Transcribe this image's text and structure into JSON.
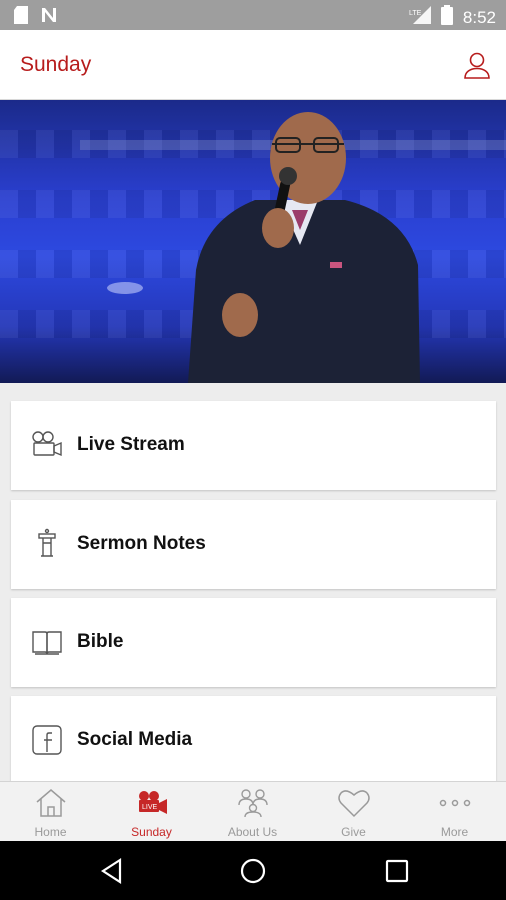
{
  "status_bar": {
    "time": "8:52"
  },
  "app_bar": {
    "title": "Sunday"
  },
  "menu": {
    "items": [
      {
        "label": "Live Stream",
        "icon": "video-camera-icon"
      },
      {
        "label": "Sermon Notes",
        "icon": "podium-icon"
      },
      {
        "label": "Bible",
        "icon": "open-book-icon"
      },
      {
        "label": "Social Media",
        "icon": "facebook-icon"
      }
    ]
  },
  "tabs": [
    {
      "label": "Home",
      "icon": "home-icon",
      "active": false
    },
    {
      "label": "Sunday",
      "icon": "video-camera-icon",
      "active": true
    },
    {
      "label": "About Us",
      "icon": "people-icon",
      "active": false
    },
    {
      "label": "Give",
      "icon": "heart-icon",
      "active": false
    },
    {
      "label": "More",
      "icon": "more-dots-icon",
      "active": false
    }
  ],
  "colors": {
    "accent": "#b71c1c",
    "inactive_tab": "#9a9a9a",
    "hero_blue": "#2d49e0"
  }
}
